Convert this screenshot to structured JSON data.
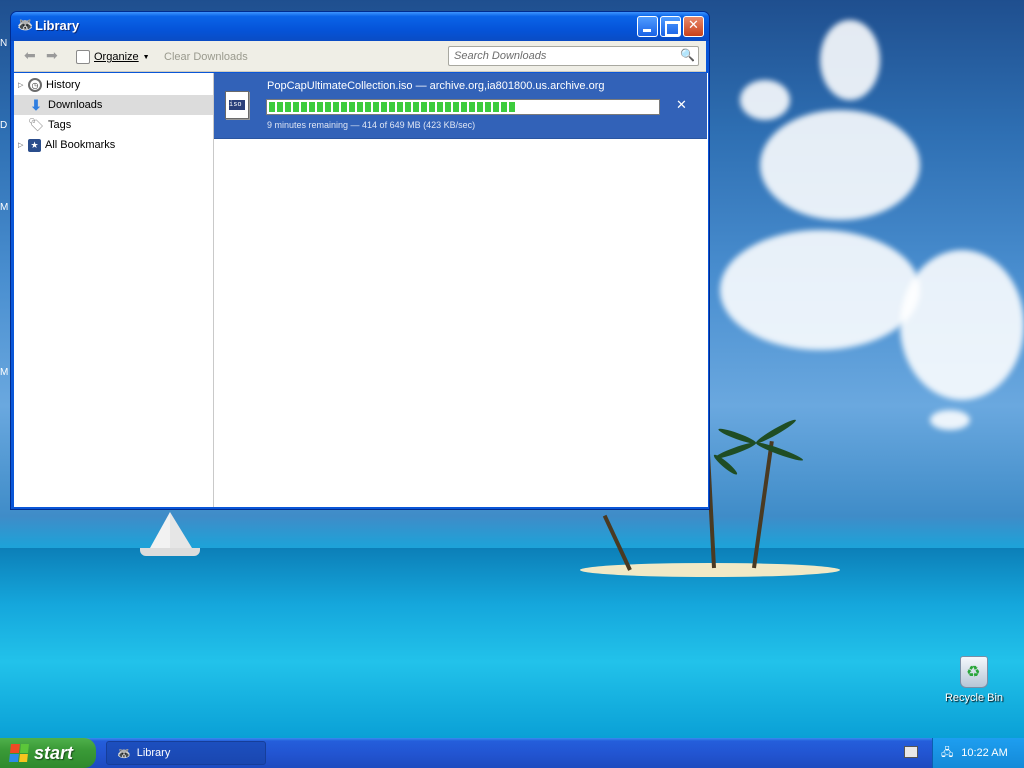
{
  "window": {
    "title": "Library",
    "toolbar": {
      "organize_label": "Organize",
      "clear_label": "Clear Downloads",
      "search_placeholder": "Search Downloads"
    },
    "sidebar": {
      "items": [
        {
          "label": "History",
          "icon": "clock-icon",
          "expandable": true,
          "selected": false
        },
        {
          "label": "Downloads",
          "icon": "download-arrow-icon",
          "expandable": false,
          "selected": true
        },
        {
          "label": "Tags",
          "icon": "tag-icon",
          "expandable": false,
          "selected": false
        },
        {
          "label": "All Bookmarks",
          "icon": "bookmarks-star-icon",
          "expandable": true,
          "selected": false
        }
      ]
    },
    "downloads": [
      {
        "name": "PopCapUltimateCollection.iso — archive.org,ia801800.us.archive.org",
        "status": "9 minutes remaining — 414 of 649 MB (423 KB/sec)",
        "progress": 0.638
      }
    ]
  },
  "desktop": {
    "recycle_bin_label": "Recycle Bin",
    "edge_letters": [
      "N",
      "D",
      "M",
      "M"
    ]
  },
  "taskbar": {
    "start_label": "start",
    "task_button_label": "Library",
    "clock": "10:22 AM"
  },
  "colors": {
    "titlebar_blue": "#0554d9",
    "selection_blue": "#3262b8",
    "progress_green": "#3dcc3d",
    "start_green": "#3a9a37"
  }
}
